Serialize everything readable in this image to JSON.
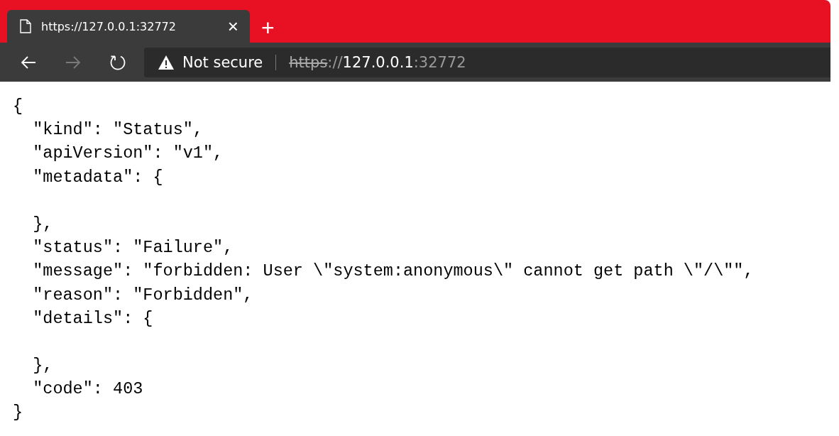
{
  "tab": {
    "title": "https://127.0.0.1:32772",
    "selected": true,
    "close": "×"
  },
  "new_tab": "+",
  "nav": {
    "back_disabled": false,
    "forward_disabled": true
  },
  "address": {
    "security": "Not secure",
    "url_parts": [
      {
        "text": "https",
        "kind": "struck"
      },
      {
        "text": "://",
        "kind": "dim"
      },
      {
        "text": "127.0.0.1",
        "kind": "bright"
      },
      {
        "text": ":32772",
        "kind": "dim"
      }
    ]
  },
  "body": {
    "lines": [
      {
        "kind": "text",
        "text": "{"
      },
      {
        "kind": "text",
        "text": "  \"kind\": \"Status\","
      },
      {
        "kind": "text",
        "text": "  \"apiVersion\": \"v1\","
      },
      {
        "kind": "text",
        "text": "  \"metadata\": {"
      },
      {
        "kind": "blank"
      },
      {
        "kind": "text",
        "text": "  },"
      },
      {
        "kind": "text",
        "text": "  \"status\": \"Failure\","
      },
      {
        "kind": "text",
        "text": "  \"message\": \"forbidden: User \\\"system:anonymous\\\" cannot get path \\\"/\\\"\","
      },
      {
        "kind": "text",
        "text": "  \"reason\": \"Forbidden\","
      },
      {
        "kind": "text",
        "text": "  \"details\": {"
      },
      {
        "kind": "blank"
      },
      {
        "kind": "text",
        "text": "  },"
      },
      {
        "kind": "text",
        "text": "  \"code\": 403"
      },
      {
        "kind": "text",
        "text": "}"
      }
    ]
  }
}
